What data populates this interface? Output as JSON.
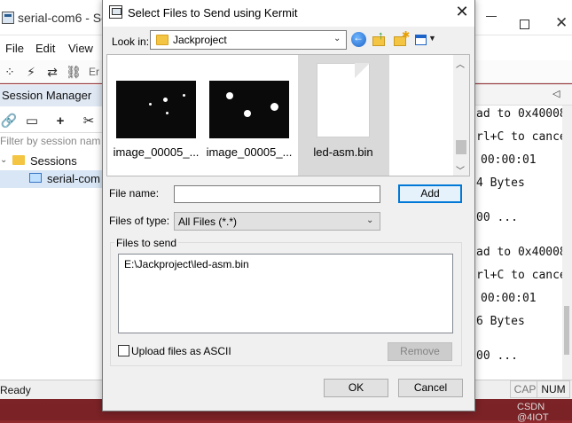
{
  "background_window": {
    "title": "serial-com6 - Se",
    "menu": [
      "File",
      "Edit",
      "View"
    ],
    "toolbar_trailing_text": "Er",
    "session_manager": {
      "header": "Session Manager",
      "filter_placeholder": "Filter by session nam",
      "folder_label": "Sessions",
      "item_label": "serial-com"
    },
    "terminal_lines": [
      "ad to 0x40008",
      "rl+C to cance",
      "00:00:01",
      "4 Bytes",
      "00 ...",
      "ad to 0x40008",
      "rl+C to cance",
      "00:00:01",
      "6 Bytes",
      "00 ..."
    ],
    "status_text": "Ready",
    "status_cap": "CAP",
    "status_num": "NUM"
  },
  "dialog": {
    "title": "Select Files to Send using Kermit",
    "look_in_label": "Look in:",
    "look_in_value": "Jackproject",
    "files": [
      {
        "name": "image_00005_...",
        "type": "image"
      },
      {
        "name": "image_00005_...",
        "type": "image"
      },
      {
        "name": "led-asm.bin",
        "type": "document"
      }
    ],
    "file_name_label": "File name:",
    "file_name_value": "",
    "add_label": "Add",
    "files_of_type_label": "Files of type:",
    "files_of_type_value": "All Files (*.*)",
    "files_to_send_label": "Files to send",
    "files_to_send": [
      "E:\\Jackproject\\led-asm.bin"
    ],
    "upload_ascii_label": "Upload files as ASCII",
    "upload_ascii_checked": false,
    "remove_label": "Remove",
    "ok_label": "OK",
    "cancel_label": "Cancel"
  },
  "watermark": "CSDN @4IOT",
  "colors": {
    "desktop_accent": "#8e2a2e",
    "focus_blue": "#0078d7",
    "selection": "#d9d9d9",
    "folder": "#f4c542"
  }
}
